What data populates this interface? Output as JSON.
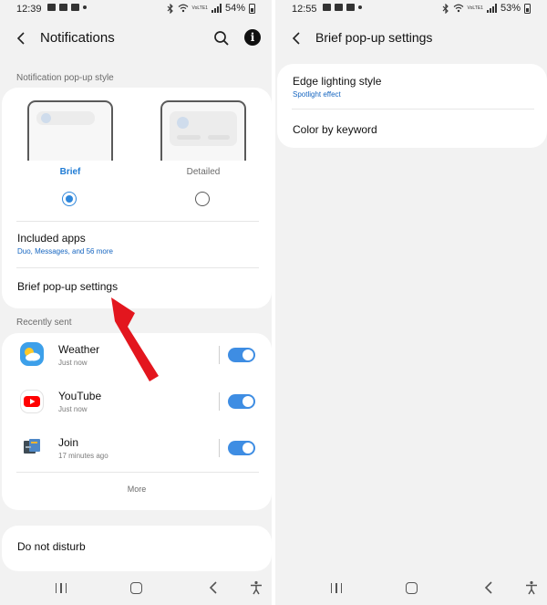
{
  "left": {
    "status": {
      "time": "12:39",
      "battery": "54%",
      "net_label": "VoLTE1"
    },
    "header": {
      "title": "Notifications",
      "info_glyph": "i"
    },
    "section_popup": "Notification pop-up style",
    "styles": [
      {
        "label": "Brief",
        "selected": true
      },
      {
        "label": "Detailed",
        "selected": false
      }
    ],
    "included_apps": {
      "title": "Included apps",
      "subtitle": "Duo, Messages, and 56 more"
    },
    "brief_settings": {
      "title": "Brief pop-up settings"
    },
    "section_recent": "Recently sent",
    "recent": [
      {
        "name": "Weather",
        "time": "Just now",
        "icon": "weather-icon",
        "enabled": true
      },
      {
        "name": "YouTube",
        "time": "Just now",
        "icon": "youtube-icon",
        "enabled": true
      },
      {
        "name": "Join",
        "time": "17 minutes ago",
        "icon": "join-icon",
        "enabled": true
      }
    ],
    "more_label": "More",
    "dnd": {
      "title": "Do not disturb"
    }
  },
  "right": {
    "status": {
      "time": "12:55",
      "battery": "53%",
      "net_label": "VoLTE1"
    },
    "header": {
      "title": "Brief pop-up settings"
    },
    "items": [
      {
        "title": "Edge lighting style",
        "subtitle": "Spotlight effect"
      },
      {
        "title": "Color by keyword"
      }
    ]
  },
  "colors": {
    "accent": "#2f87db",
    "subtitle_blue": "#1565c0",
    "toggle": "#3e8de3",
    "annotation_arrow": "#e3161e"
  }
}
